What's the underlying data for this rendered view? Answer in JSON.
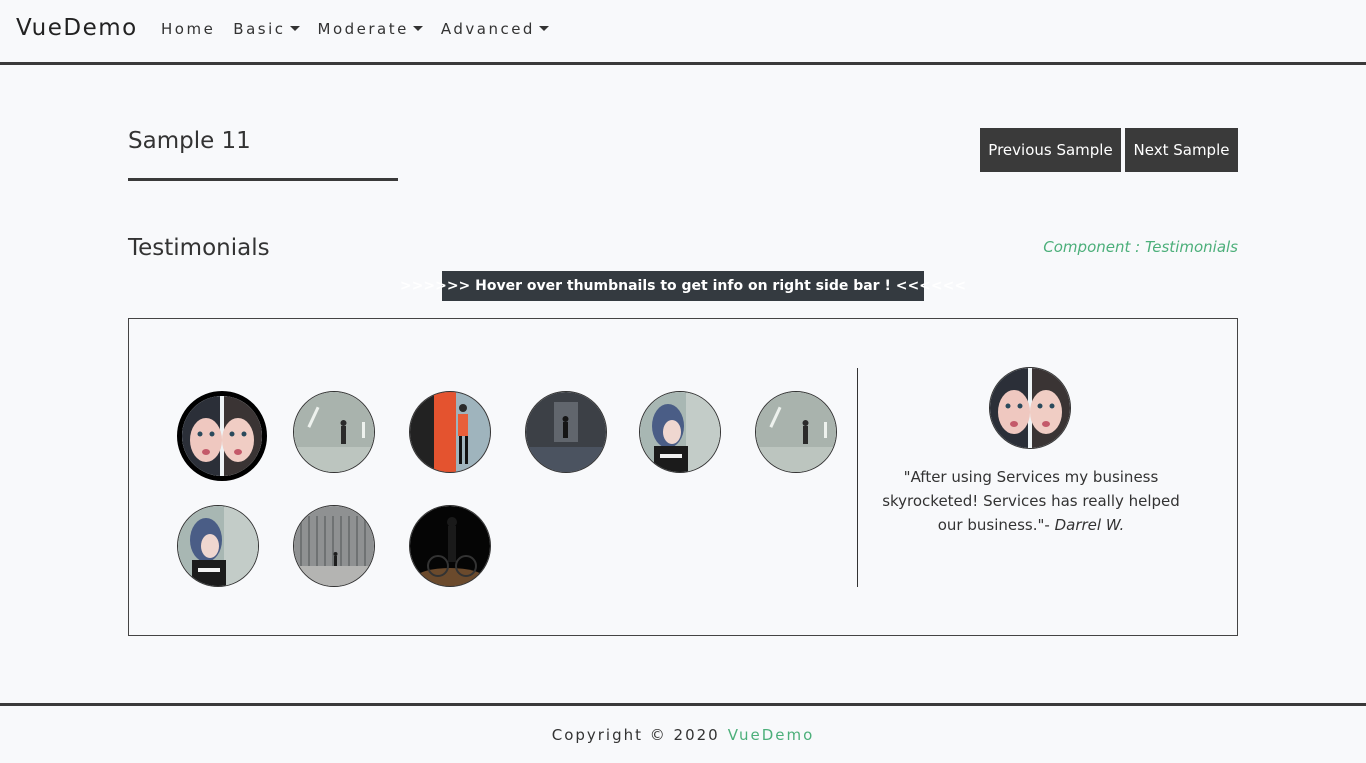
{
  "navbar": {
    "brand": "VueDemo",
    "items": [
      {
        "label": "Home",
        "dropdown": false
      },
      {
        "label": "Basic",
        "dropdown": true
      },
      {
        "label": "Moderate",
        "dropdown": true
      },
      {
        "label": "Advanced",
        "dropdown": true
      }
    ]
  },
  "page": {
    "title": "Sample 11",
    "prev_button": "Previous Sample",
    "next_button": "Next Sample"
  },
  "section": {
    "title": "Testimonials",
    "component_label": "Component : Testimonials",
    "hint": ">>>>>> Hover over thumbnails to get info on right side bar ! <<<<<<"
  },
  "testimonial": {
    "quote": "\"After using Services my business skyrocketed! Services has really helped our business.\"",
    "separator": "- ",
    "author": "Darrel W."
  },
  "thumbnails": [
    {
      "name": "thumb-1",
      "subject": "woman-split-face",
      "active": true
    },
    {
      "name": "thumb-2",
      "subject": "person-walking-wall",
      "active": false
    },
    {
      "name": "thumb-3",
      "subject": "person-orange-door",
      "active": false
    },
    {
      "name": "thumb-4",
      "subject": "dark-corridor",
      "active": false
    },
    {
      "name": "thumb-5",
      "subject": "woman-blue-hair",
      "active": false
    },
    {
      "name": "thumb-6",
      "subject": "person-walking-wall",
      "active": false
    },
    {
      "name": "thumb-7",
      "subject": "woman-blue-hair",
      "active": false
    },
    {
      "name": "thumb-8",
      "subject": "person-walking-fence",
      "active": false
    },
    {
      "name": "thumb-9",
      "subject": "person-bicycle-dark",
      "active": false
    }
  ],
  "footer": {
    "copyright": "Copyright © 2020",
    "brand": "VueDemo"
  },
  "colors": {
    "accent": "#4caf7a",
    "dark": "#3a3a3a",
    "background": "#f8f9fb"
  }
}
